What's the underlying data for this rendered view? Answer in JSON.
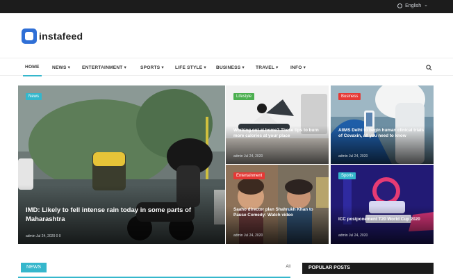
{
  "topbar": {
    "language": "English",
    "globe_icon": "globe-icon",
    "chevron_icon": "chevron-down-icon"
  },
  "brand": {
    "name": "instafeed",
    "logo_icon": "instafeed-logo-icon",
    "accent": "#35b7cc",
    "logo_color": "#2f6fd6"
  },
  "nav": {
    "items": [
      {
        "label": "HOME",
        "active": true
      },
      {
        "label": "NEWS ▾"
      },
      {
        "label": "ENTERTAINMENT ▾"
      },
      {
        "label": "SPORTS ▾"
      },
      {
        "label": "LIFE STYLE ▾"
      },
      {
        "label": "BUSINESS ▾"
      },
      {
        "label": "TRAVEL ▾"
      },
      {
        "label": "INFO ▾"
      }
    ],
    "search_icon": "search-icon"
  },
  "featured": {
    "hero": {
      "category": "News",
      "title": "IMD: Likely to fell intense rain today in some parts of Maharashtra",
      "meta": "admin  Jul 24, 2020  0  0"
    },
    "tiles": [
      {
        "category": "Lifestyle",
        "category_color": "#4caf50",
        "title": "Working out at home? These tips to burn more calories at your place",
        "meta": "admin  Jul 24, 2020"
      },
      {
        "category": "Business",
        "category_color": "#e53935",
        "title": "AIIMS Delhi to begin human clinical trials of Covaxin, all you need to know",
        "meta": "admin  Jul 24, 2020"
      },
      {
        "category": "Entertainment",
        "category_color": "#e53935",
        "title": "Saaho director plan Shahrukh Khan to Pause Comedy: Watch video",
        "meta": "admin  Jul 24, 2020"
      },
      {
        "category": "Sports",
        "category_color": "#35b7cc",
        "title": "ICC postponement T20 World Cup 2020",
        "meta": "admin  Jul 24, 2020"
      }
    ]
  },
  "sections": {
    "news": {
      "label": "NEWS",
      "all": "All"
    },
    "popular": {
      "label": "POPULAR POSTS"
    }
  }
}
